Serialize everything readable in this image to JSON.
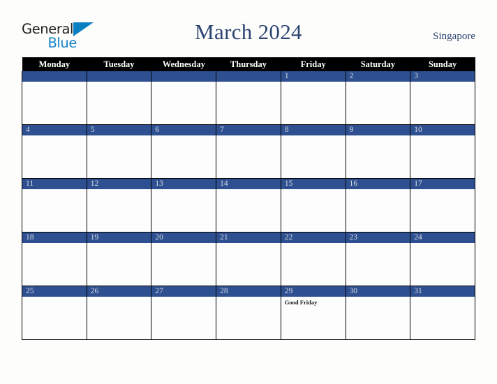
{
  "brand": {
    "name_top": "General",
    "name_bottom": "Blue",
    "triangle_icon": "blue-triangle-icon",
    "top_color": "#221f1f",
    "bottom_color": "#1383cd"
  },
  "header": {
    "title": "March 2024",
    "country": "Singapore",
    "title_color": "#2b4372"
  },
  "calendar": {
    "weekday_headers": [
      "Monday",
      "Tuesday",
      "Wednesday",
      "Thursday",
      "Friday",
      "Saturday",
      "Sunday"
    ],
    "header_bg": "#000000",
    "daynum_bg": "#2e5090",
    "cell_bg": "#fdfdfd",
    "weeks": [
      [
        {
          "day": "",
          "events": []
        },
        {
          "day": "",
          "events": []
        },
        {
          "day": "",
          "events": []
        },
        {
          "day": "",
          "events": []
        },
        {
          "day": "1",
          "events": []
        },
        {
          "day": "2",
          "events": []
        },
        {
          "day": "3",
          "events": []
        }
      ],
      [
        {
          "day": "4",
          "events": []
        },
        {
          "day": "5",
          "events": []
        },
        {
          "day": "6",
          "events": []
        },
        {
          "day": "7",
          "events": []
        },
        {
          "day": "8",
          "events": []
        },
        {
          "day": "9",
          "events": []
        },
        {
          "day": "10",
          "events": []
        }
      ],
      [
        {
          "day": "11",
          "events": []
        },
        {
          "day": "12",
          "events": []
        },
        {
          "day": "13",
          "events": []
        },
        {
          "day": "14",
          "events": []
        },
        {
          "day": "15",
          "events": []
        },
        {
          "day": "16",
          "events": []
        },
        {
          "day": "17",
          "events": []
        }
      ],
      [
        {
          "day": "18",
          "events": []
        },
        {
          "day": "19",
          "events": []
        },
        {
          "day": "20",
          "events": []
        },
        {
          "day": "21",
          "events": []
        },
        {
          "day": "22",
          "events": []
        },
        {
          "day": "23",
          "events": []
        },
        {
          "day": "24",
          "events": []
        }
      ],
      [
        {
          "day": "25",
          "events": []
        },
        {
          "day": "26",
          "events": []
        },
        {
          "day": "27",
          "events": []
        },
        {
          "day": "28",
          "events": []
        },
        {
          "day": "29",
          "events": [
            "Good Friday"
          ]
        },
        {
          "day": "30",
          "events": []
        },
        {
          "day": "31",
          "events": []
        }
      ]
    ]
  }
}
